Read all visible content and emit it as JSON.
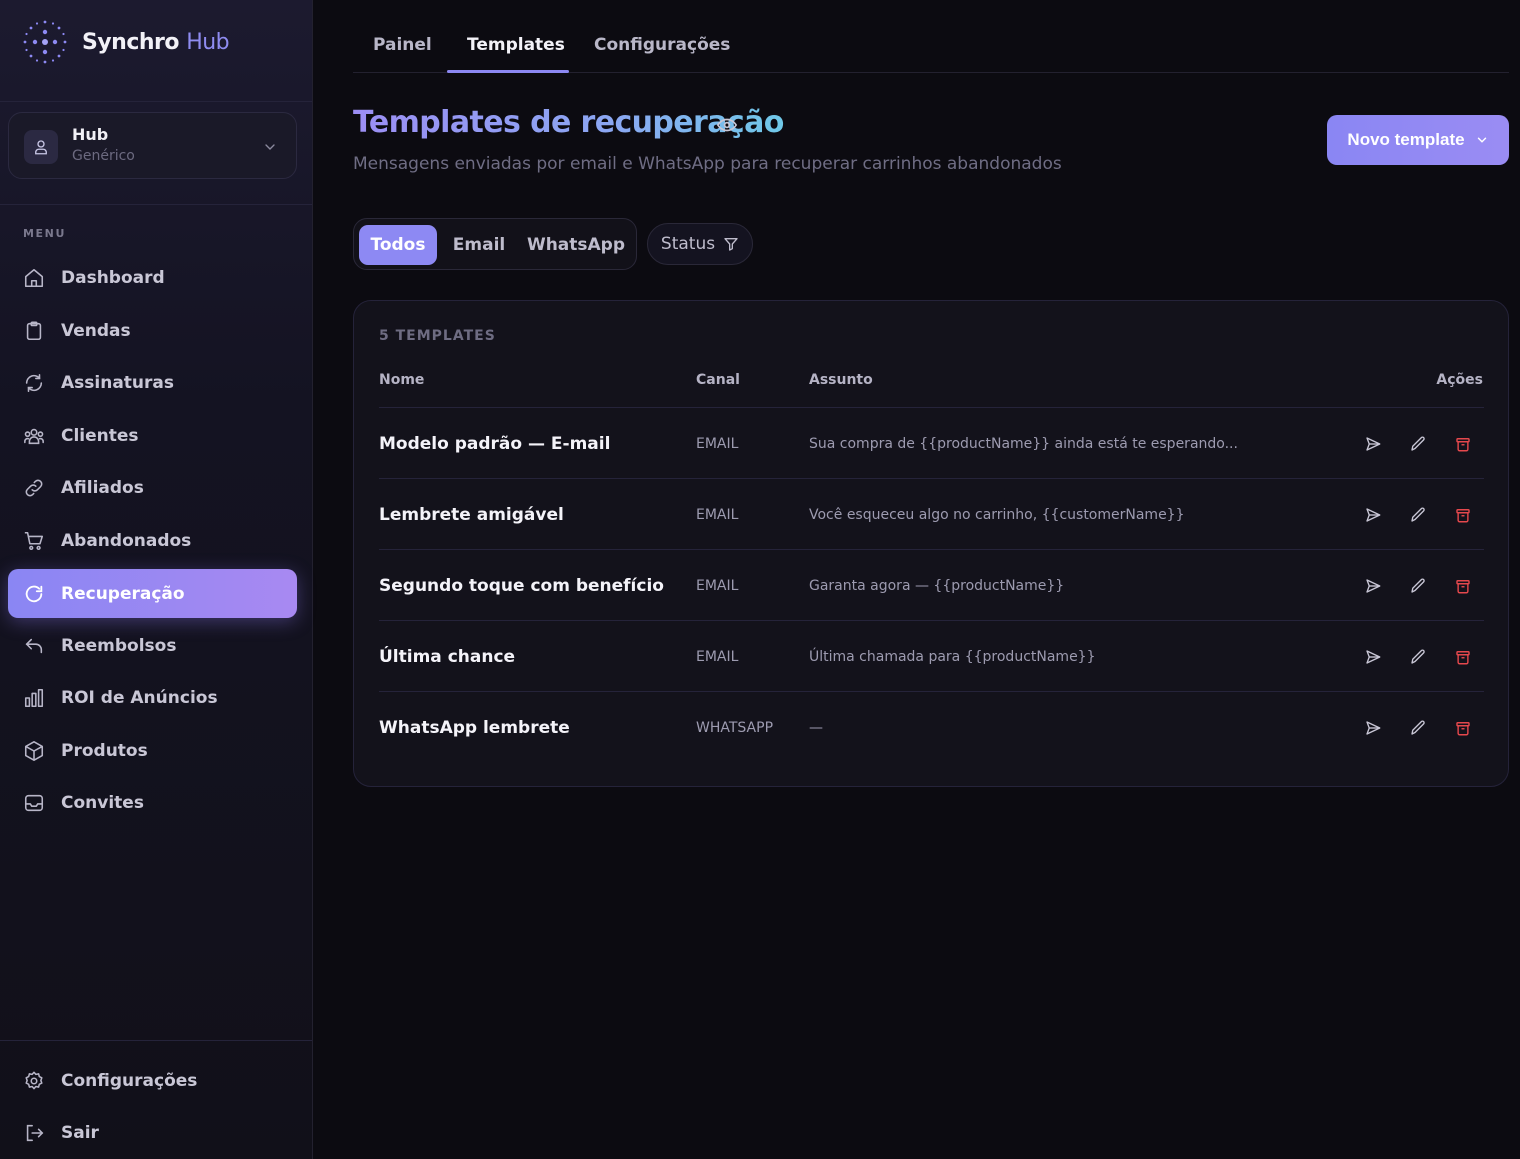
{
  "brand": {
    "name": "Synchro",
    "suffix": "Hub"
  },
  "account": {
    "name": "Hub",
    "type": "Genérico"
  },
  "sidebar": {
    "menu_title": "MENU",
    "items": [
      {
        "label": "Dashboard",
        "icon": "home-icon"
      },
      {
        "label": "Vendas",
        "icon": "clipboard-icon"
      },
      {
        "label": "Assinaturas",
        "icon": "refresh-icon"
      },
      {
        "label": "Clientes",
        "icon": "users-icon"
      },
      {
        "label": "Afiliados",
        "icon": "link-icon"
      },
      {
        "label": "Abandonados",
        "icon": "cart-icon"
      },
      {
        "label": "Recuperação",
        "icon": "rotate-icon",
        "active": true
      },
      {
        "label": "Reembolsos",
        "icon": "undo-icon"
      },
      {
        "label": "ROI de Anúncios",
        "icon": "bar-chart-icon"
      },
      {
        "label": "Produtos",
        "icon": "box-icon"
      },
      {
        "label": "Convites",
        "icon": "inbox-icon"
      }
    ],
    "footer": [
      {
        "label": "Configurações",
        "icon": "gear-icon"
      },
      {
        "label": "Sair",
        "icon": "logout-icon"
      }
    ]
  },
  "tabs": [
    {
      "label": "Painel"
    },
    {
      "label": "Templates",
      "active": true
    },
    {
      "label": "Configurações"
    }
  ],
  "header": {
    "title": "Templates de recuperação",
    "subtitle": "Mensagens enviadas por email e WhatsApp para recuperar carrinhos abandonados",
    "new_button": "Novo template"
  },
  "filters": {
    "channel_options": [
      "Todos",
      "Email",
      "WhatsApp"
    ],
    "selected": "Todos",
    "status_label": "Status"
  },
  "table": {
    "count_label": "5 TEMPLATES",
    "columns": {
      "name": "Nome",
      "channel": "Canal",
      "subject": "Assunto",
      "actions": "Ações"
    },
    "rows": [
      {
        "name": "Modelo padrão — E-mail",
        "channel": "EMAIL",
        "subject": "Sua compra de {{productName}} ainda está te esperando..."
      },
      {
        "name": "Lembrete amigável",
        "channel": "EMAIL",
        "subject": "Você esqueceu algo no carrinho, {{customerName}}"
      },
      {
        "name": "Segundo toque com benefício",
        "channel": "EMAIL",
        "subject": "Garanta agora — {{productName}}"
      },
      {
        "name": "Última chance",
        "channel": "EMAIL",
        "subject": "Última chamada para {{productName}}"
      },
      {
        "name": "WhatsApp lembrete",
        "channel": "WHATSAPP",
        "subject": "—"
      }
    ]
  },
  "colors": {
    "accent": "#8d89f3",
    "danger": "#e5484d",
    "background": "#0c0b11"
  }
}
